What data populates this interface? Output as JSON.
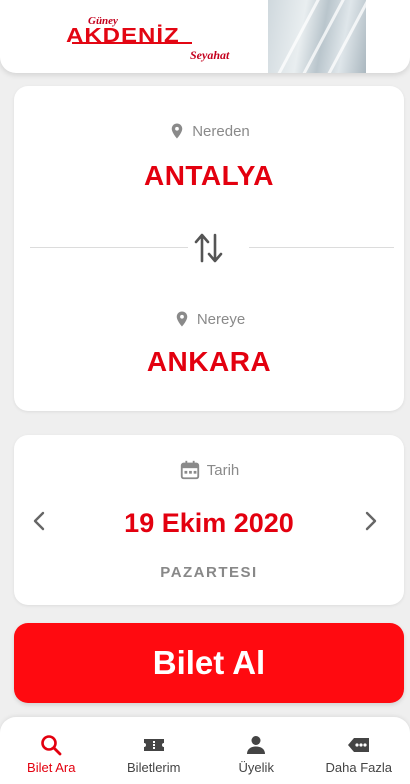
{
  "header": {
    "logo": {
      "top_text": "Güney",
      "main_text": "AKDENİZ",
      "sub_text": "Seyahat"
    }
  },
  "route": {
    "from_label": "Nereden",
    "from_city": "ANTALYA",
    "to_label": "Nereye",
    "to_city": "ANKARA"
  },
  "date": {
    "label": "Tarih",
    "value": "19 Ekim 2020",
    "day": "PAZARTESI"
  },
  "buy_button": {
    "label": "Bilet Al"
  },
  "tabs": [
    {
      "label": "Bilet Ara",
      "icon": "search-icon",
      "active": true
    },
    {
      "label": "Biletlerim",
      "icon": "ticket-icon",
      "active": false
    },
    {
      "label": "Üyelik",
      "icon": "person-icon",
      "active": false
    },
    {
      "label": "Daha Fazla",
      "icon": "more-icon",
      "active": false
    }
  ],
  "colors": {
    "accent": "#e3000f",
    "button": "#ff0a10",
    "muted": "#8a8a8a",
    "background": "#efefef"
  }
}
